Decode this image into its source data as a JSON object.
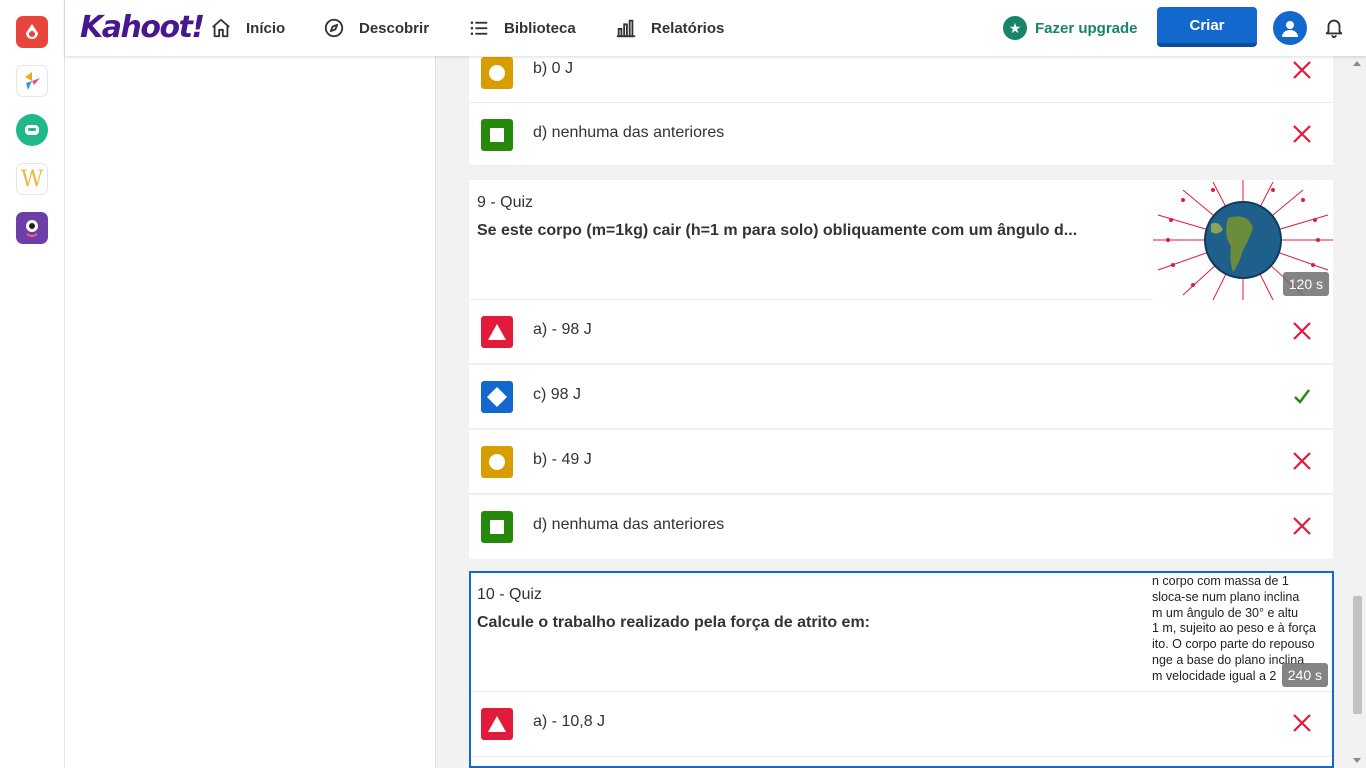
{
  "nav": {
    "logo": "Kahoot!",
    "items": [
      {
        "label": "Início",
        "icon": "home-icon"
      },
      {
        "label": "Descobrir",
        "icon": "compass-icon"
      },
      {
        "label": "Biblioteca",
        "icon": "list-icon"
      },
      {
        "label": "Relatórios",
        "icon": "bar-chart-icon"
      }
    ],
    "upgrade_label": "Fazer upgrade",
    "create_label": "Criar"
  },
  "prev_question": {
    "answers": [
      {
        "text": "b) 0 J",
        "shape": "circle",
        "color": "#d89e00",
        "correct": false
      },
      {
        "text": "d) nenhuma das anteriores",
        "shape": "square",
        "color": "#26890c",
        "correct": false
      }
    ]
  },
  "question9": {
    "header": "9 - Quiz",
    "title": "Se este corpo (m=1kg) cair (h=1 m para solo) obliquamente com um ângulo d...",
    "time": "120 s",
    "answers": [
      {
        "text": "a) - 98 J",
        "shape": "triangle",
        "color": "#e21b3c",
        "correct": false
      },
      {
        "text": "c) 98 J",
        "shape": "diamond",
        "color": "#1368ce",
        "correct": true
      },
      {
        "text": "b) - 49 J",
        "shape": "circle",
        "color": "#d89e00",
        "correct": false
      },
      {
        "text": "d) nenhuma das anteriores",
        "shape": "square",
        "color": "#26890c",
        "correct": false
      }
    ]
  },
  "question10": {
    "header": "10 - Quiz",
    "title": "Calcule o trabalho realizado pela força de atrito em:",
    "time": "240 s",
    "image_text": [
      "n corpo com massa de 1",
      "sloca-se num plano inclina",
      "m um ângulo de 30° e altu",
      "1 m, sujeito ao peso e à força",
      "ito. O corpo parte do repouso",
      "nge a base do plano inclina",
      "m velocidade igual a 2"
    ],
    "answers": [
      {
        "text": "a) - 10,8 J",
        "shape": "triangle",
        "color": "#e21b3c",
        "correct": false
      }
    ]
  },
  "colors": {
    "brand": "#46178f",
    "primary": "#1368ce",
    "wrong": "#e21b3c",
    "right": "#26890c",
    "upgrade": "#1a8468"
  }
}
